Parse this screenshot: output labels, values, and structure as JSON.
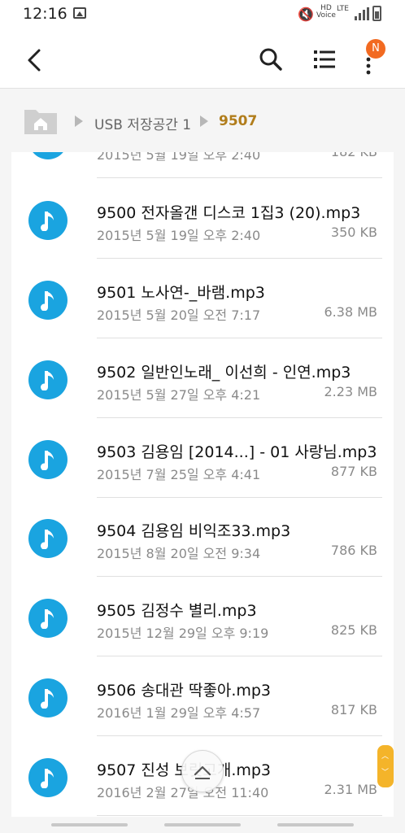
{
  "status_bar": {
    "time": "12:16",
    "hd_top": "HD",
    "hd_bottom": "Voice",
    "network": "LTE"
  },
  "toolbar": {
    "notification_badge": "N",
    "icons": [
      "back-arrow-icon",
      "search-icon",
      "list-view-icon",
      "more-vert-icon"
    ]
  },
  "breadcrumb": {
    "items": [
      "USB 저장공간 1",
      "9507"
    ]
  },
  "files": [
    {
      "name": "",
      "date": "2015년 5월 19일 오후 2:40",
      "size": "182 KB"
    },
    {
      "name": "9500 전자올갠 디스코 1집3 (20).mp3",
      "date": "2015년 5월 19일 오후 2:40",
      "size": "350 KB"
    },
    {
      "name": "9501 노사연-_바램.mp3",
      "date": "2015년 5월 20일 오전 7:17",
      "size": "6.38 MB"
    },
    {
      "name": "9502 일반인노래_ 이선희 - 인연.mp3",
      "date": "2015년 5월 27일 오후 4:21",
      "size": "2.23 MB"
    },
    {
      "name": "9503 김용임 [2014...] - 01 사랑님.mp3",
      "date": "2015년 7월 25일 오후 4:41",
      "size": "877 KB"
    },
    {
      "name": "9504 김용임 비익조33.mp3",
      "date": "2015년 8월 20일 오전 9:34",
      "size": "786 KB"
    },
    {
      "name": "9505 김정수   별리.mp3",
      "date": "2015년 12월 29일 오후 9:19",
      "size": "825 KB"
    },
    {
      "name": "9506 송대관 딱좋아.mp3",
      "date": "2016년 1월 29일 오후 4:57",
      "size": "817 KB"
    },
    {
      "name": "9507 진성 보릿고개.mp3",
      "date": "2016년 2월 27일 오전 11:40",
      "size": "2.31 MB"
    }
  ],
  "colors": {
    "accent_breadcrumb": "#b17d1b",
    "music_icon_bg": "#1aa4e0",
    "badge": "#f26a21",
    "scroll_handle": "#f4b42a"
  }
}
